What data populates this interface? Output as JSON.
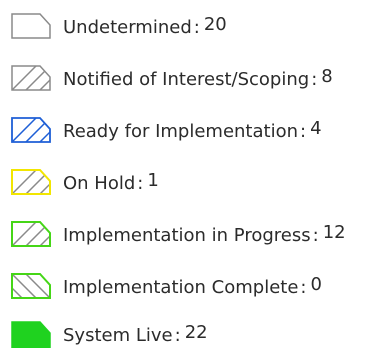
{
  "legend": {
    "items": [
      {
        "label": "Undetermined",
        "count": "20",
        "stroke": "#8a8a8a",
        "fill": "#ffffff",
        "hatch": "none",
        "icon": "empty-polygon-swatch"
      },
      {
        "label": "Notified of Interest/Scoping",
        "count": "8",
        "stroke": "#8a8a8a",
        "fill": "#ffffff",
        "hatch": "forward",
        "icon": "gray-hatched-swatch"
      },
      {
        "label": "Ready for Implementation",
        "count": "4",
        "stroke": "#1e5fd6",
        "fill": "#ffffff",
        "hatch": "forward",
        "icon": "blue-hatched-swatch"
      },
      {
        "label": "On Hold",
        "count": "1",
        "stroke": "#f2e600",
        "fill": "#ffffff",
        "hatch": "forward",
        "icon": "yellow-hatched-swatch"
      },
      {
        "label": "Implementation in Progress",
        "count": "12",
        "stroke": "#45d617",
        "fill": "#ffffff",
        "hatch": "forward",
        "icon": "green-hatched-swatch"
      },
      {
        "label": "Implementation Complete",
        "count": "0",
        "stroke": "#45d617",
        "fill": "#ffffff",
        "hatch": "backward",
        "icon": "green-backhatched-swatch"
      },
      {
        "label": "System Live",
        "count": "22",
        "stroke": "#1fd21f",
        "fill": "#1fd21f",
        "hatch": "solid",
        "icon": "green-solid-swatch"
      }
    ]
  }
}
